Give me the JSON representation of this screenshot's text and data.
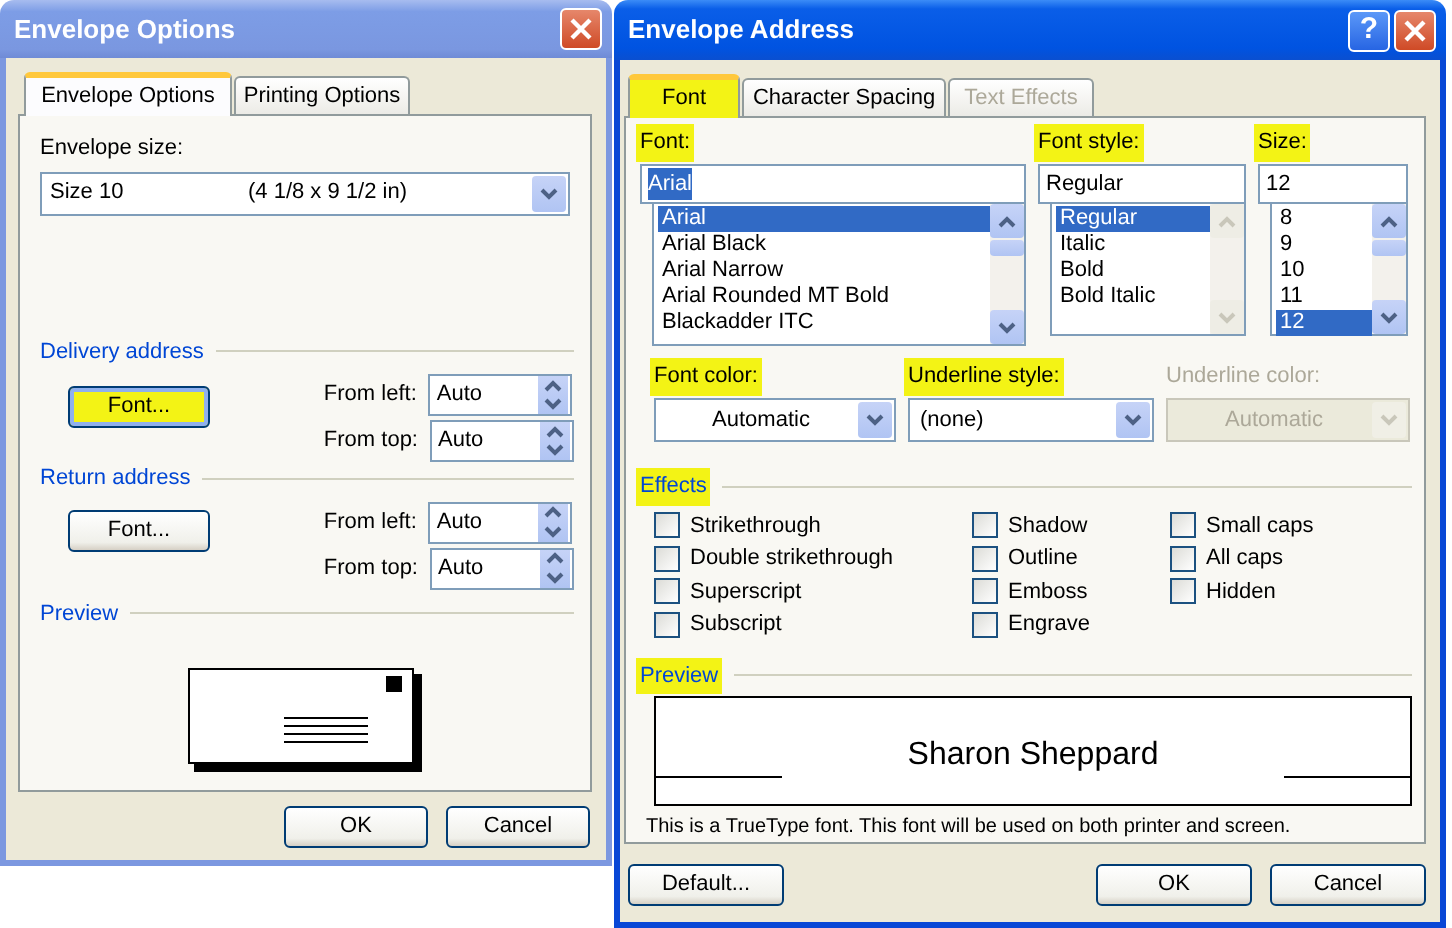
{
  "envelope_options": {
    "title": "Envelope Options",
    "active": false,
    "tabs": [
      {
        "label": "Envelope Options",
        "selected": true
      },
      {
        "label": "Printing Options",
        "selected": false
      }
    ],
    "envelope_size": {
      "label": "Envelope size:",
      "value": "Size 10",
      "dimensions": "(4 1/8 x 9 1/2 in)"
    },
    "delivery_address": {
      "heading": "Delivery address",
      "font_button": {
        "label": "Font...",
        "highlighted": true
      },
      "from_left": {
        "label": "From left:",
        "value": "Auto"
      },
      "from_top": {
        "label": "From top:",
        "value": "Auto"
      }
    },
    "return_address": {
      "heading": "Return address",
      "font_button": {
        "label": "Font...",
        "highlighted": false
      },
      "from_left": {
        "label": "From left:",
        "value": "Auto"
      },
      "from_top": {
        "label": "From top:",
        "value": "Auto"
      }
    },
    "preview": {
      "heading": "Preview"
    },
    "buttons": [
      "OK",
      "Cancel"
    ]
  },
  "envelope_address": {
    "title": "Envelope Address",
    "active": true,
    "help_glyph": "?",
    "tabs": [
      {
        "label": "Font",
        "selected": true,
        "disabled": false,
        "highlighted": true
      },
      {
        "label": "Character Spacing",
        "selected": false,
        "disabled": false,
        "highlighted": false
      },
      {
        "label": "Text Effects",
        "selected": false,
        "disabled": true,
        "highlighted": false
      }
    ],
    "font": {
      "label": "Font:",
      "highlighted": true,
      "value": "Arial",
      "value_selected": true,
      "items": [
        {
          "label": "Arial",
          "selected": true
        },
        {
          "label": "Arial Black",
          "selected": false
        },
        {
          "label": "Arial Narrow",
          "selected": false
        },
        {
          "label": "Arial Rounded MT Bold",
          "selected": false
        },
        {
          "label": "Blackadder ITC",
          "selected": false
        }
      ]
    },
    "font_style": {
      "label": "Font style:",
      "highlighted": true,
      "value": "Regular",
      "value_selected": false,
      "items": [
        {
          "label": "Regular",
          "selected": true
        },
        {
          "label": "Italic",
          "selected": false
        },
        {
          "label": "Bold",
          "selected": false
        },
        {
          "label": "Bold Italic",
          "selected": false
        }
      ]
    },
    "size": {
      "label": "Size:",
      "highlighted": true,
      "value": "12",
      "value_selected": false,
      "items": [
        {
          "label": "8",
          "selected": false
        },
        {
          "label": "9",
          "selected": false
        },
        {
          "label": "10",
          "selected": false
        },
        {
          "label": "11",
          "selected": false
        },
        {
          "label": "12",
          "selected": true
        }
      ]
    },
    "dropdowns": [
      {
        "label": "Font color:",
        "highlighted": true,
        "value": "Automatic",
        "disabled": false,
        "kind": "color"
      },
      {
        "label": "Underline style:",
        "highlighted": true,
        "value": "(none)",
        "disabled": false,
        "kind": "style"
      },
      {
        "label": "Underline color:",
        "highlighted": false,
        "value": "Automatic",
        "disabled": true,
        "kind": "color"
      }
    ],
    "effects": {
      "heading": "Effects",
      "highlighted": true,
      "columns": [
        [
          {
            "label": "Strikethrough",
            "checked": false
          },
          {
            "label": "Double strikethrough",
            "checked": false
          },
          {
            "label": "Superscript",
            "checked": false
          },
          {
            "label": "Subscript",
            "checked": false
          }
        ],
        [
          {
            "label": "Shadow",
            "checked": false
          },
          {
            "label": "Outline",
            "checked": false
          },
          {
            "label": "Emboss",
            "checked": false
          },
          {
            "label": "Engrave",
            "checked": false
          }
        ],
        [
          {
            "label": "Small caps",
            "checked": false
          },
          {
            "label": "All caps",
            "checked": false
          },
          {
            "label": "Hidden",
            "checked": false
          }
        ]
      ]
    },
    "preview": {
      "heading": "Preview",
      "highlighted": true,
      "sample": "Sharon Sheppard",
      "note": "This is a TrueType font. This font will be used on both printer and screen."
    },
    "buttons": [
      "Default...",
      "OK",
      "Cancel"
    ]
  }
}
